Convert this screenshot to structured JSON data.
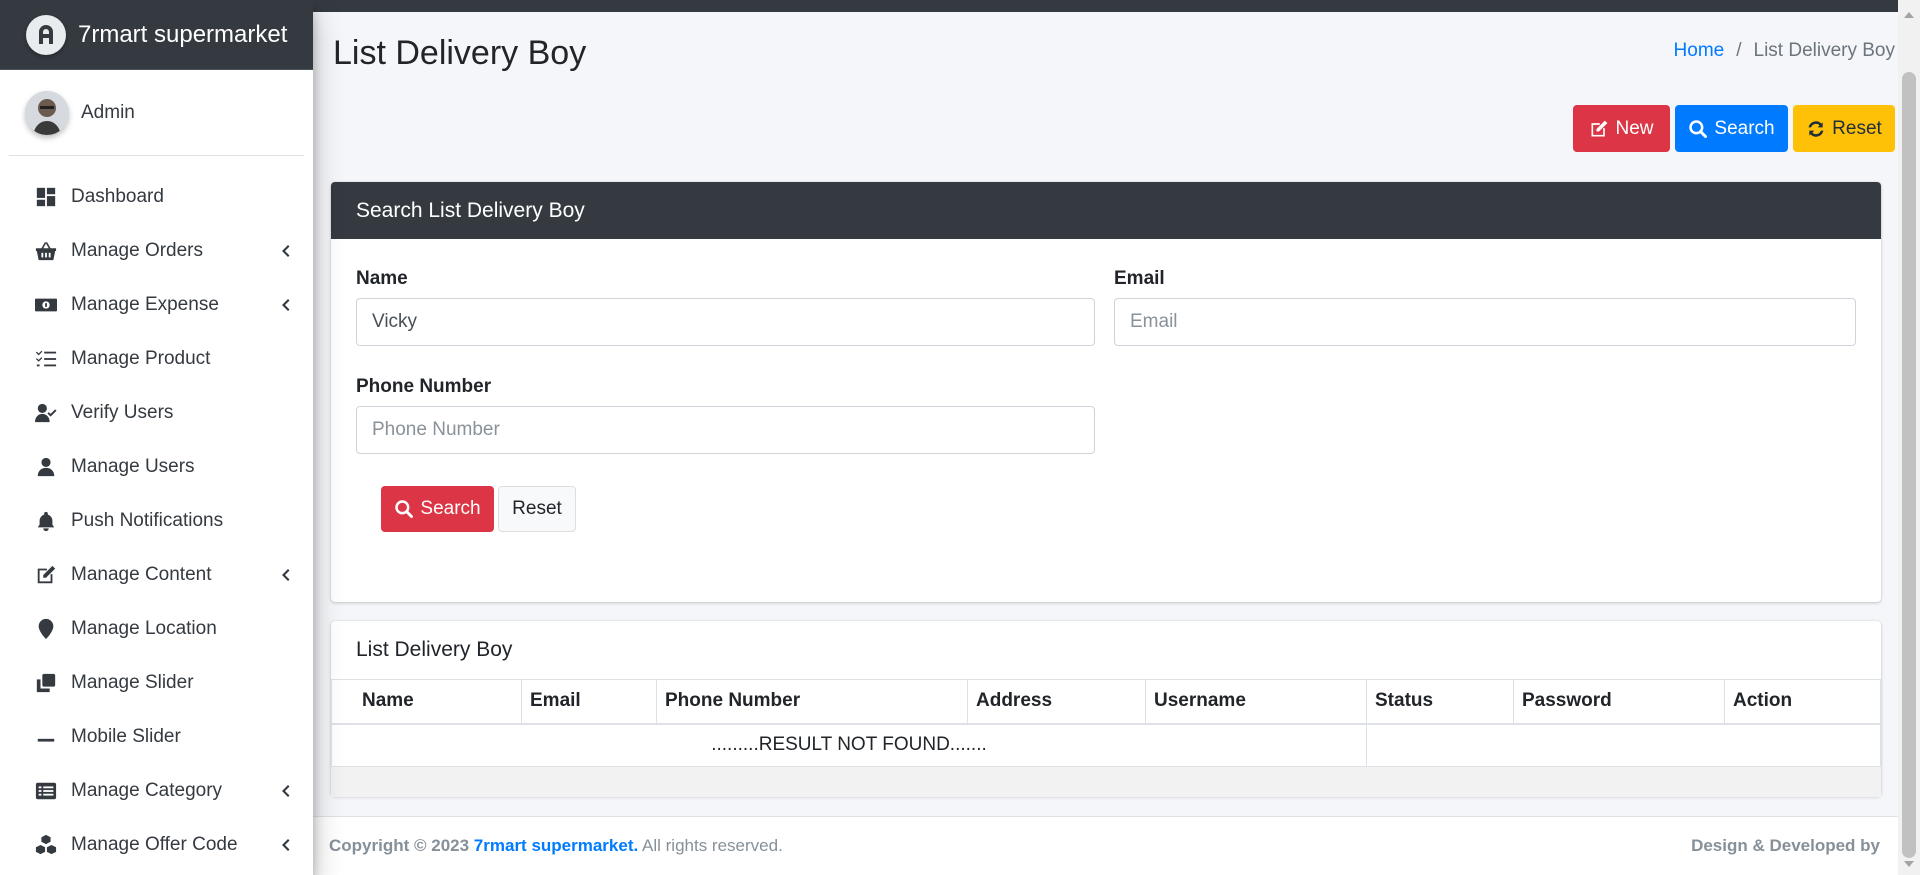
{
  "brand": {
    "name": "7rmart supermarket"
  },
  "user": {
    "name": "Admin"
  },
  "sidebar": {
    "items": [
      {
        "label": "Dashboard",
        "icon": "dashboard-icon",
        "has_submenu": false
      },
      {
        "label": "Manage Orders",
        "icon": "basket-icon",
        "has_submenu": true
      },
      {
        "label": "Manage Expense",
        "icon": "money-bill-icon",
        "has_submenu": true
      },
      {
        "label": "Manage Product",
        "icon": "tasks-icon",
        "has_submenu": false
      },
      {
        "label": "Verify Users",
        "icon": "user-check-icon",
        "has_submenu": false
      },
      {
        "label": "Manage Users",
        "icon": "user-icon",
        "has_submenu": false
      },
      {
        "label": "Push Notifications",
        "icon": "bell-icon",
        "has_submenu": false
      },
      {
        "label": "Manage Content",
        "icon": "edit-icon",
        "has_submenu": true
      },
      {
        "label": "Manage Location",
        "icon": "map-marker-icon",
        "has_submenu": false
      },
      {
        "label": "Manage Slider",
        "icon": "clone-icon",
        "has_submenu": false
      },
      {
        "label": "Mobile Slider",
        "icon": "minus-icon",
        "has_submenu": false
      },
      {
        "label": "Manage Category",
        "icon": "list-alt-icon",
        "has_submenu": true
      },
      {
        "label": "Manage Offer Code",
        "icon": "cubes-icon",
        "has_submenu": true
      }
    ]
  },
  "page": {
    "title": "List Delivery Boy",
    "breadcrumb": {
      "home": "Home",
      "separator": "/",
      "current": "List Delivery Boy"
    }
  },
  "actions": {
    "new_label": "New",
    "search_label": "Search",
    "reset_label": "Reset"
  },
  "search_form": {
    "title": "Search List Delivery Boy",
    "name_label": "Name",
    "name_value": "Vicky",
    "email_label": "Email",
    "email_placeholder": "Email",
    "phone_label": "Phone Number",
    "phone_placeholder": "Phone Number",
    "search_button": "Search",
    "reset_button": "Reset"
  },
  "list": {
    "title": "List Delivery Boy",
    "columns": [
      "Name",
      "Email",
      "Phone Number",
      "Address",
      "Username",
      "Status",
      "Password",
      "Action"
    ],
    "empty_message": ".........RESULT NOT FOUND......."
  },
  "footer": {
    "copyright_prefix": "Copyright © 2023",
    "brand": "7rmart supermarket.",
    "rights": "All rights reserved.",
    "developer": "Design & Developed by"
  },
  "colors": {
    "sidebar_dark": "#343a40",
    "primary": "#007bff",
    "danger": "#dc3545",
    "warning": "#ffc107"
  }
}
